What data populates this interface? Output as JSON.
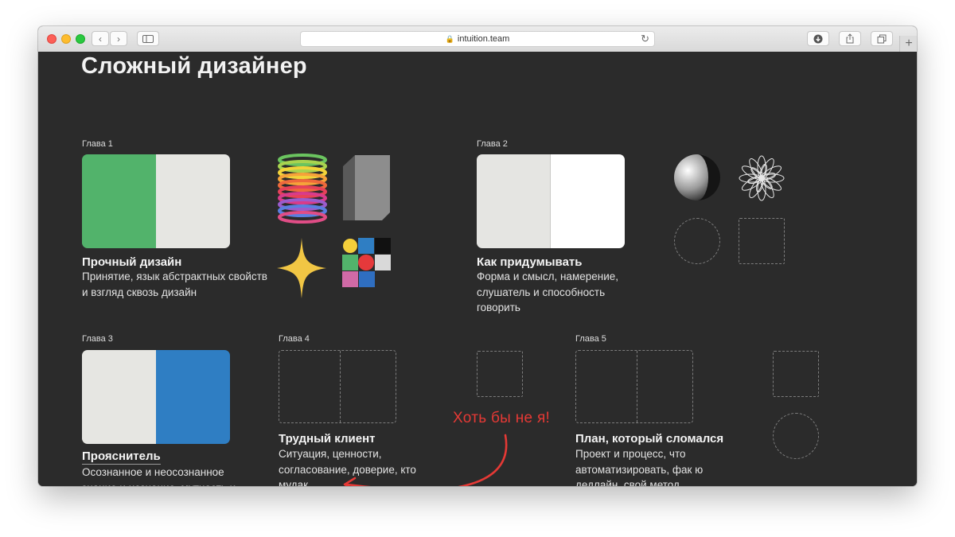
{
  "browser": {
    "url": "intuition.team",
    "colors": {
      "close": "#fc5f57",
      "minimize": "#fdbc2e",
      "zoom": "#29c840"
    }
  },
  "page": {
    "title": "Сложный дизайнер"
  },
  "chapters": [
    {
      "label": "Глава 1",
      "title": "Прочный дизайн",
      "description": "Принятие, язык абстрактных свойств и взгляд сквозь дизайн",
      "cover_colors": [
        "#52b36b",
        "#e6e6e2"
      ]
    },
    {
      "label": "Глава 2",
      "title": "Как придумывать",
      "description": "Форма и смысл, намерение, слушатель и способность говорить",
      "cover_colors": [
        "#e5e5e2",
        "#ffffff"
      ]
    },
    {
      "label": "Глава 3",
      "title": "Прояснитель",
      "description": "Осознанное и неосознанное знание и незнание, мутность и хорошие вопросы",
      "cover_colors": [
        "#e6e6e2",
        "#2f7ec3"
      ]
    },
    {
      "label": "Глава 4",
      "title": "Трудный клиент",
      "description": "Ситуация, ценности, согласование, доверие, кто мудак"
    },
    {
      "label": "Глава 5",
      "title": "План, который сломался",
      "description": "Проект и процесс, что автоматизировать, фак ю дедлайн, свой метод"
    }
  ],
  "annotation": {
    "text": "Хоть бы не я!",
    "color": "#e53935"
  },
  "icons": [
    "rainbow-spring-icon",
    "grey-block-icon",
    "sparkle-star-icon",
    "color-grid-icon",
    "moon-sphere-icon",
    "mandala-flower-icon"
  ]
}
